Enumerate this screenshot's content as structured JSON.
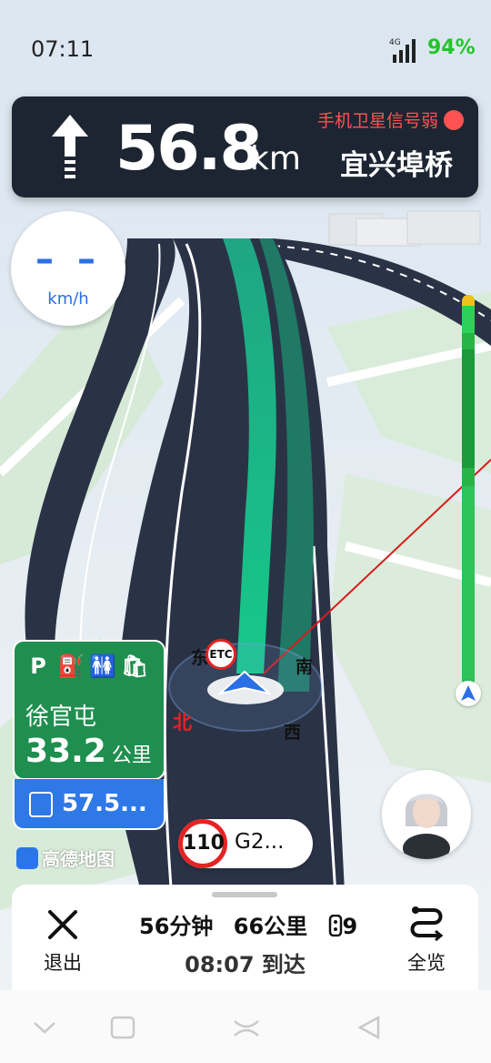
{
  "status_bar": {
    "time": "07:11",
    "network": "4G",
    "battery": "94%"
  },
  "guidance": {
    "distance": "56.8",
    "distance_unit": "km",
    "road_name": "宜兴埠桥",
    "gps_warning": "手机卫星信号弱",
    "maneuver_icon": "arrow-straight-icon"
  },
  "speedometer": {
    "value": "– –",
    "unit": "km/h"
  },
  "compass": {
    "east": "东",
    "south": "南",
    "north": "北",
    "west": "西",
    "toll_badge": "ETC"
  },
  "service_area": {
    "icons": [
      "P",
      "⛽",
      "🚻",
      "🛍"
    ],
    "name": "徐官屯",
    "distance": "33.2",
    "distance_unit": "公里",
    "next_label": "57.5..."
  },
  "brand": "高德地图",
  "road_sign": {
    "speed_limit": "110",
    "road_code": "G2..."
  },
  "trip": {
    "duration": "56分钟",
    "distance": "66公里",
    "traffic_lights": "9",
    "arrival": "08:07 到达",
    "exit_label": "退出",
    "overview_label": "全览"
  },
  "colors": {
    "route_green": "#1ec97a",
    "banner_bg": "#1d2532",
    "service_card": "#1f8f4f",
    "accent_blue": "#2a6fe6",
    "warning_red": "#ff5252"
  }
}
